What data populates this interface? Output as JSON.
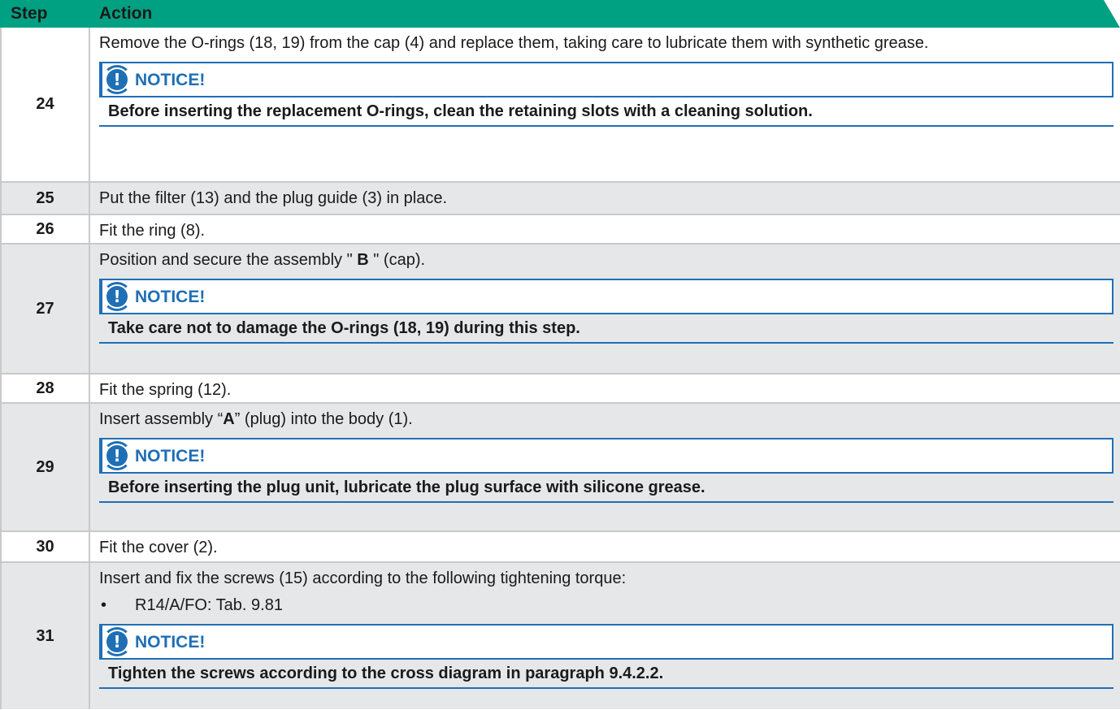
{
  "header": {
    "step": "Step",
    "action": "Action"
  },
  "rows": [
    {
      "step": "24",
      "text": "Remove the O-rings (18, 19) from the cap (4) and replace them, taking care to lubricate them with synthetic grease.",
      "notice_label": "NOTICE!",
      "notice_text": "Before inserting the replacement O-rings, clean the retaining slots with a cleaning solution."
    },
    {
      "step": "25",
      "text": "Put the filter (13) and the plug guide (3) in place."
    },
    {
      "step": "26",
      "text": "Fit the ring (8)."
    },
    {
      "step": "27",
      "text_before": "Position and secure the assembly \" ",
      "text_bold": "B",
      "text_after": " \" (cap).",
      "notice_label": "NOTICE!",
      "notice_text": "Take care not to damage the O-rings (18, 19) during this step."
    },
    {
      "step": "28",
      "text": "Fit the spring (12)."
    },
    {
      "step": "29",
      "text_before": "Insert assembly “",
      "text_bold": "A",
      "text_after": "” (plug) into the body (1).",
      "notice_label": "NOTICE!",
      "notice_text": "Before inserting the plug unit, lubricate the plug surface with silicone grease."
    },
    {
      "step": "30",
      "text": "Fit the cover (2)."
    },
    {
      "step": "31",
      "text": "Insert and fix the screws (15) according to the following tightening torque:",
      "bullet_mark": "•",
      "bullet": "R14/A/FO: Tab. 9.81",
      "notice_label": "NOTICE!",
      "notice_text": "Tighten the screws according to the cross diagram in paragraph 9.4.2.2."
    }
  ],
  "colors": {
    "header_bg": "#00a082",
    "notice_blue": "#1f6fb5",
    "row_grey": "#e6e7e8"
  },
  "icons": {
    "notice": "exclamation-circle-icon",
    "notice_glyph": "!"
  }
}
